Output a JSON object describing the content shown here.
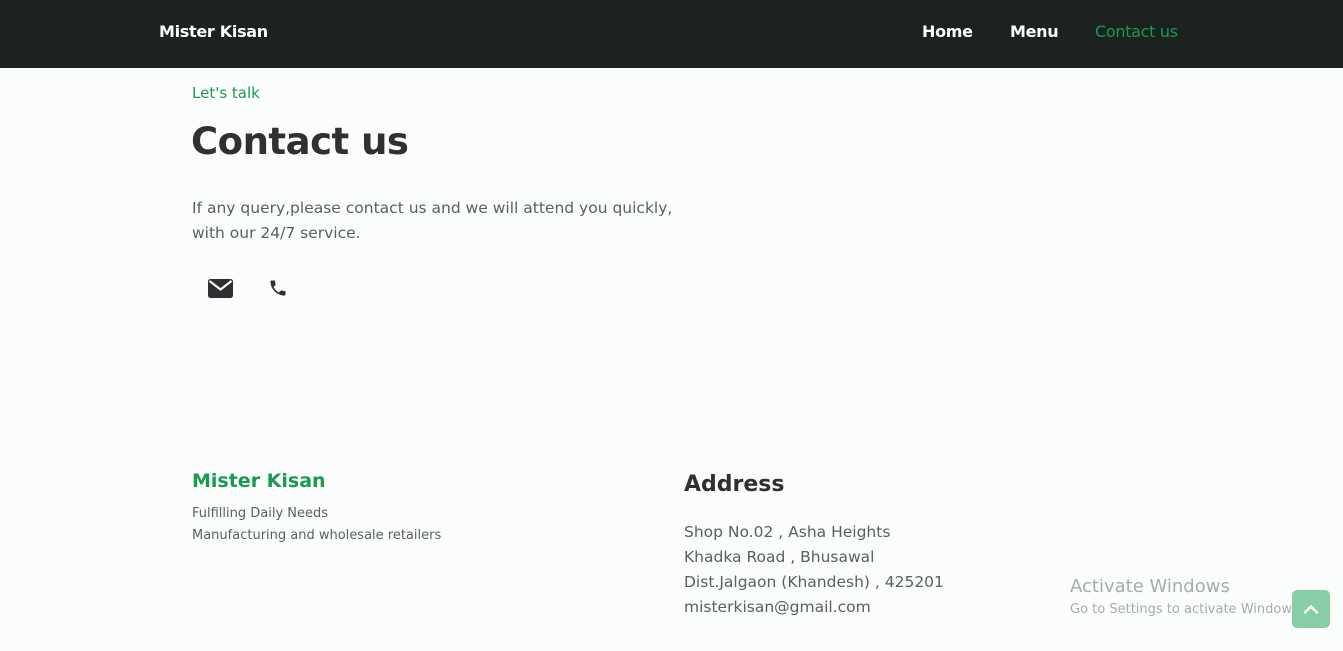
{
  "navbar": {
    "brand": "Mister Kisan",
    "links": [
      {
        "label": "Home"
      },
      {
        "label": "Menu"
      },
      {
        "label": "Contact us",
        "active": true
      }
    ]
  },
  "hero": {
    "eyebrow": "Let's talk",
    "title": "Contact us",
    "intro_line1": "If any query,please contact us and we will attend you quickly,",
    "intro_line2": "with our 24/7 service.",
    "icons": [
      "envelope-icon",
      "phone-icon"
    ]
  },
  "footer": {
    "brand": "Mister Kisan",
    "taglines": [
      "Fulfilling Daily Needs",
      "Manufacturing and wholesale retailers"
    ],
    "address": {
      "heading": "Address",
      "lines": [
        "Shop No.02 , Asha Heights",
        "Khadka Road , Bhusawal",
        "Dist.Jalgaon (Khandesh) , 425201",
        "misterkisan@gmail.com"
      ]
    }
  },
  "watermark": {
    "title": "Activate Windows",
    "subtitle": "Go to Settings to activate Windows."
  },
  "scroll_top_icon": "chevron-up-icon",
  "colors": {
    "navbar_bg": "#1b221f",
    "accent": "#1a9a51",
    "scroll_button": "#86cfa5"
  }
}
